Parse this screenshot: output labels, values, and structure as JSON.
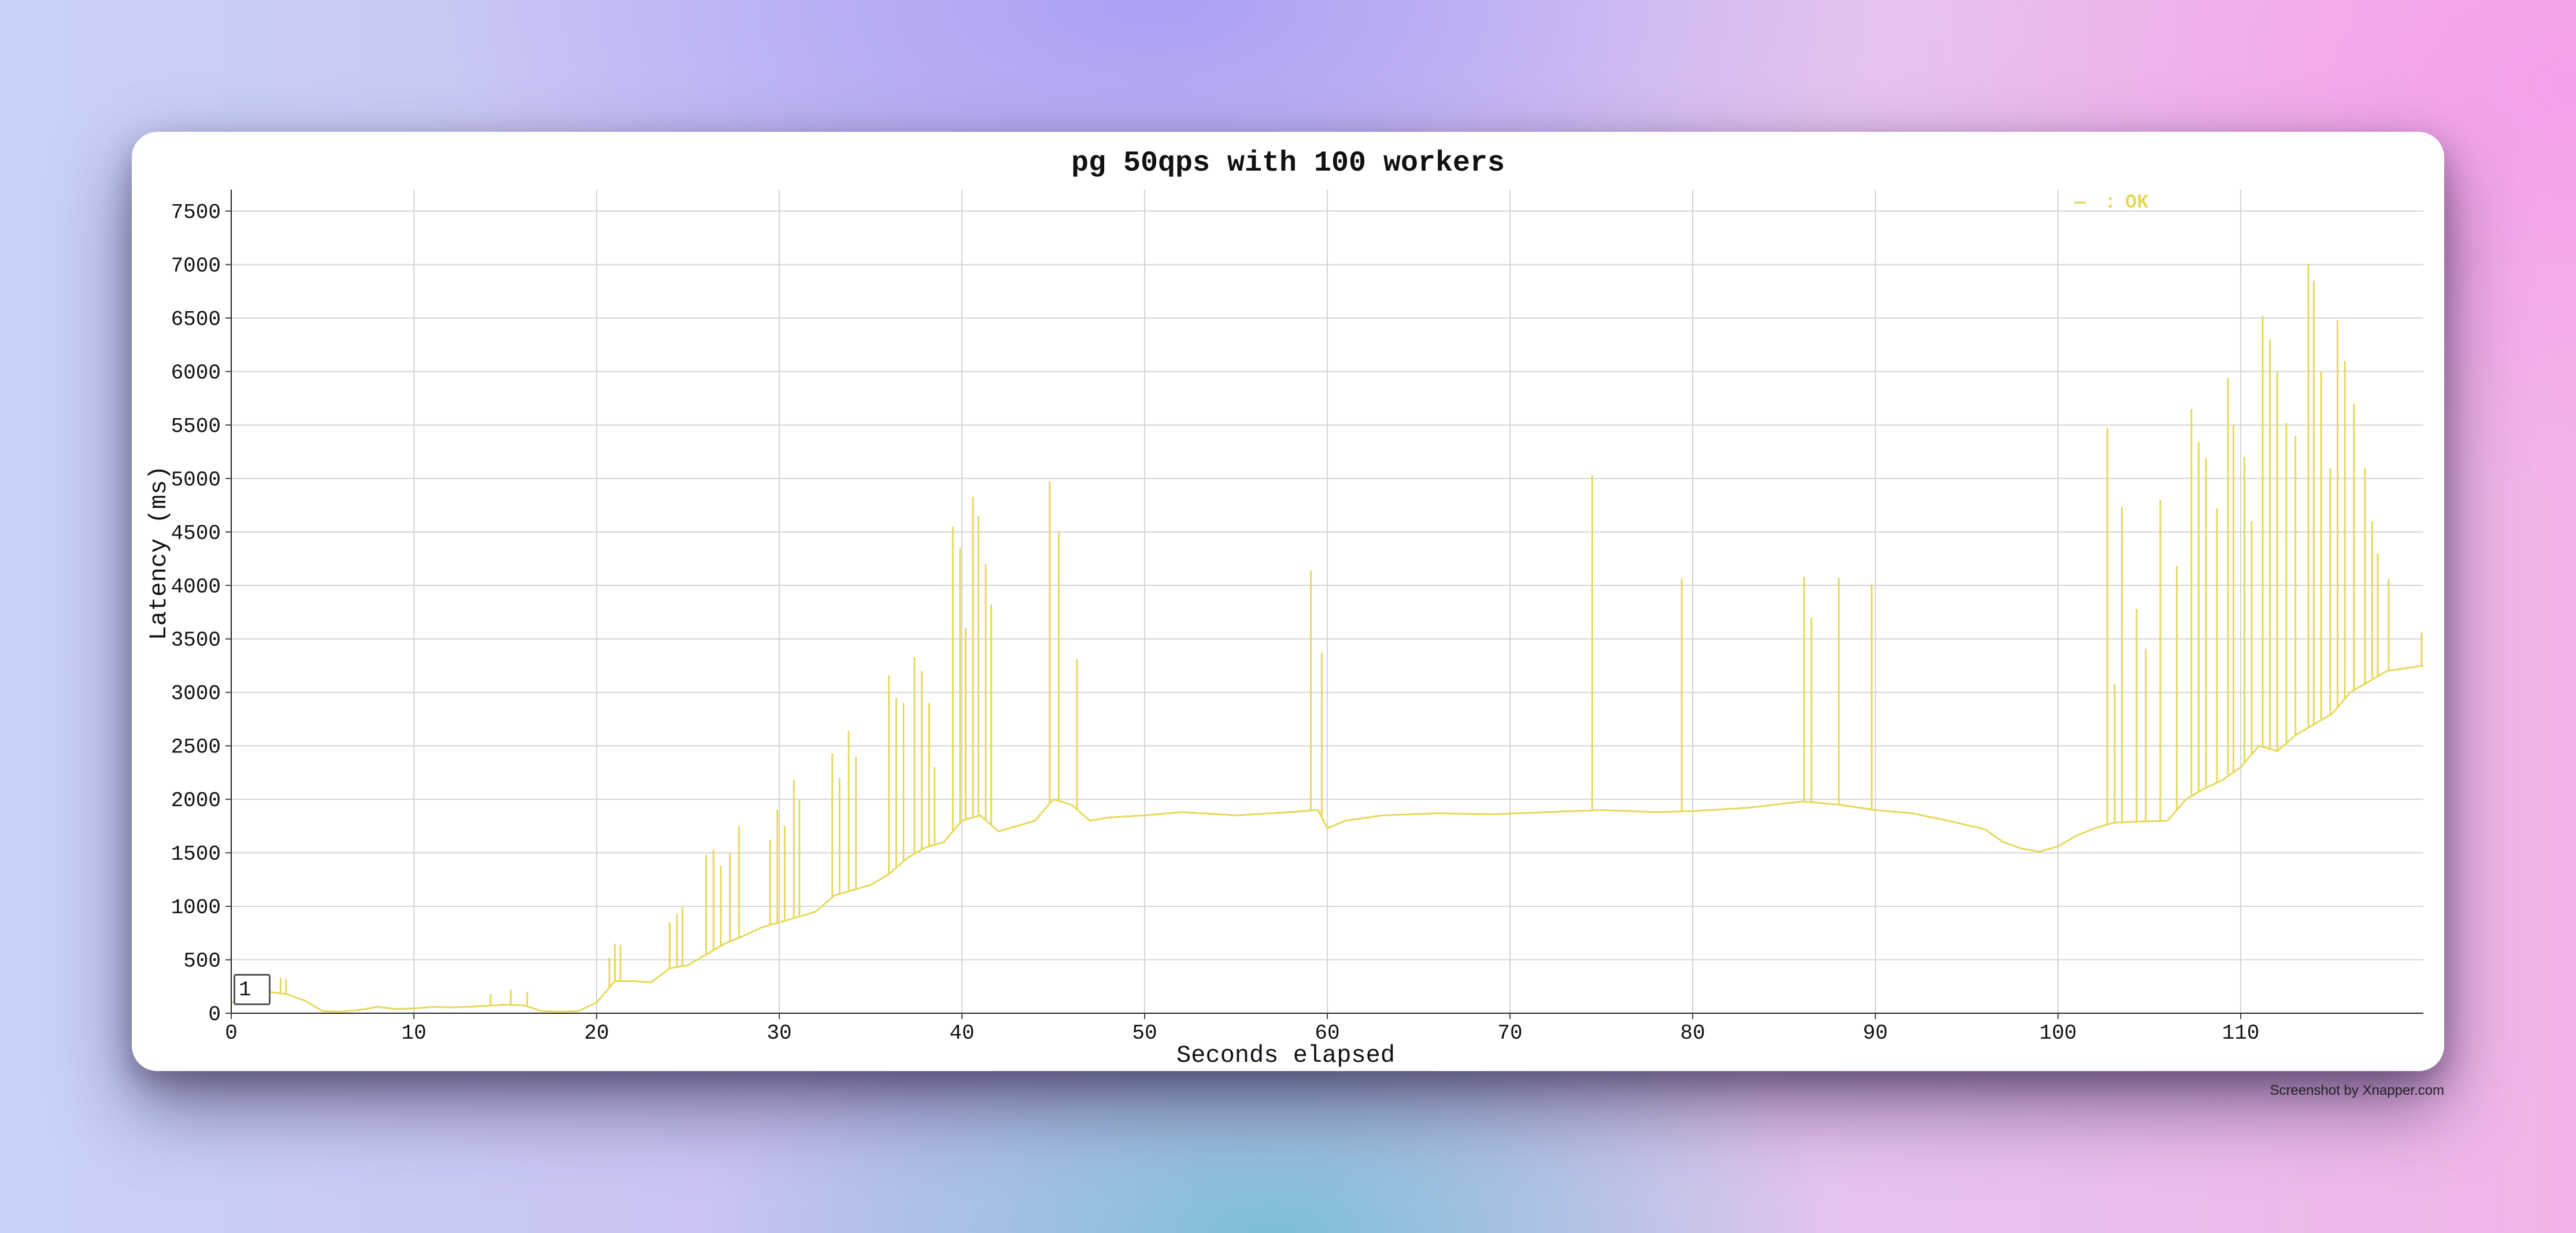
{
  "chart_data": {
    "type": "line",
    "title": "pg 50qps with 100 workers",
    "xlabel": "Seconds elapsed",
    "ylabel": "Latency (ms)",
    "xlim": [
      0,
      120
    ],
    "ylim": [
      0,
      7700
    ],
    "x_ticks": [
      0,
      10,
      20,
      30,
      40,
      50,
      60,
      70,
      80,
      90,
      100,
      110
    ],
    "y_ticks": [
      0,
      500,
      1000,
      1500,
      2000,
      2500,
      3000,
      3500,
      4000,
      4500,
      5000,
      5500,
      6000,
      6500,
      7000,
      7500
    ],
    "grid": true,
    "legend_position": "top-right",
    "series": [
      {
        "name": "OK",
        "color": "#e6d95a",
        "baseline": [
          [
            0,
            100
          ],
          [
            1,
            180
          ],
          [
            2,
            200
          ],
          [
            3,
            180
          ],
          [
            4,
            120
          ],
          [
            5,
            20
          ],
          [
            6,
            15
          ],
          [
            7,
            30
          ],
          [
            8,
            60
          ],
          [
            9,
            40
          ],
          [
            10,
            45
          ],
          [
            11,
            60
          ],
          [
            12,
            55
          ],
          [
            13,
            60
          ],
          [
            14,
            70
          ],
          [
            15,
            80
          ],
          [
            16,
            75
          ],
          [
            17,
            20
          ],
          [
            18,
            15
          ],
          [
            19,
            20
          ],
          [
            20,
            100
          ],
          [
            21,
            300
          ],
          [
            22,
            300
          ],
          [
            23,
            290
          ],
          [
            24,
            420
          ],
          [
            25,
            450
          ],
          [
            26,
            550
          ],
          [
            27,
            650
          ],
          [
            28,
            720
          ],
          [
            29,
            800
          ],
          [
            30,
            850
          ],
          [
            31,
            900
          ],
          [
            32,
            950
          ],
          [
            33,
            1100
          ],
          [
            34,
            1150
          ],
          [
            35,
            1200
          ],
          [
            36,
            1300
          ],
          [
            37,
            1450
          ],
          [
            38,
            1550
          ],
          [
            39,
            1600
          ],
          [
            40,
            1800
          ],
          [
            41,
            1850
          ],
          [
            42,
            1700
          ],
          [
            43,
            1750
          ],
          [
            44,
            1800
          ],
          [
            45,
            2000
          ],
          [
            46,
            1950
          ],
          [
            47,
            1800
          ],
          [
            48,
            1830
          ],
          [
            50,
            1850
          ],
          [
            52,
            1880
          ],
          [
            55,
            1850
          ],
          [
            58,
            1880
          ],
          [
            59.5,
            1900
          ],
          [
            60,
            1730
          ],
          [
            61,
            1800
          ],
          [
            63,
            1850
          ],
          [
            66,
            1870
          ],
          [
            69,
            1860
          ],
          [
            72,
            1880
          ],
          [
            75,
            1900
          ],
          [
            78,
            1880
          ],
          [
            80,
            1890
          ],
          [
            83,
            1920
          ],
          [
            86,
            1980
          ],
          [
            88,
            1950
          ],
          [
            90,
            1900
          ],
          [
            92,
            1870
          ],
          [
            94,
            1800
          ],
          [
            96,
            1720
          ],
          [
            97,
            1600
          ],
          [
            98,
            1540
          ],
          [
            99,
            1510
          ],
          [
            100,
            1560
          ],
          [
            101,
            1660
          ],
          [
            102,
            1730
          ],
          [
            103,
            1780
          ],
          [
            104,
            1790
          ],
          [
            106,
            1800
          ],
          [
            107,
            2000
          ],
          [
            108,
            2100
          ],
          [
            109,
            2180
          ],
          [
            110,
            2300
          ],
          [
            111,
            2500
          ],
          [
            112,
            2450
          ],
          [
            113,
            2600
          ],
          [
            114,
            2700
          ],
          [
            115,
            2800
          ],
          [
            116,
            3000
          ],
          [
            117,
            3100
          ],
          [
            118,
            3200
          ],
          [
            120,
            3250
          ]
        ],
        "spikes": [
          [
            2.7,
            330
          ],
          [
            3.0,
            320
          ],
          [
            14.2,
            180
          ],
          [
            15.3,
            220
          ],
          [
            16.2,
            200
          ],
          [
            20.7,
            520
          ],
          [
            21.0,
            650
          ],
          [
            21.3,
            640
          ],
          [
            24.0,
            850
          ],
          [
            24.4,
            930
          ],
          [
            24.7,
            990
          ],
          [
            26.0,
            1480
          ],
          [
            26.4,
            1530
          ],
          [
            26.8,
            1380
          ],
          [
            27.3,
            1500
          ],
          [
            27.8,
            1750
          ],
          [
            29.5,
            1620
          ],
          [
            29.9,
            1900
          ],
          [
            30.3,
            1750
          ],
          [
            30.8,
            2180
          ],
          [
            31.1,
            2000
          ],
          [
            32.9,
            2430
          ],
          [
            33.3,
            2200
          ],
          [
            33.8,
            2640
          ],
          [
            34.2,
            2400
          ],
          [
            36.0,
            3160
          ],
          [
            36.4,
            2950
          ],
          [
            36.8,
            2900
          ],
          [
            37.4,
            3330
          ],
          [
            37.8,
            3200
          ],
          [
            38.2,
            2900
          ],
          [
            38.5,
            2300
          ],
          [
            39.5,
            4550
          ],
          [
            39.9,
            4350
          ],
          [
            40.2,
            3600
          ],
          [
            40.6,
            4830
          ],
          [
            40.9,
            4650
          ],
          [
            41.3,
            4200
          ],
          [
            41.6,
            3820
          ],
          [
            44.8,
            4970
          ],
          [
            45.3,
            4500
          ],
          [
            46.3,
            3310
          ],
          [
            59.1,
            4140
          ],
          [
            59.7,
            3370
          ],
          [
            74.5,
            5030
          ],
          [
            79.4,
            4060
          ],
          [
            86.1,
            4080
          ],
          [
            86.5,
            3700
          ],
          [
            88.0,
            4070
          ],
          [
            89.8,
            4010
          ],
          [
            102.7,
            5470
          ],
          [
            103.1,
            3080
          ],
          [
            103.5,
            4730
          ],
          [
            104.3,
            3780
          ],
          [
            104.8,
            3410
          ],
          [
            105.6,
            4800
          ],
          [
            106.5,
            4180
          ],
          [
            107.3,
            5650
          ],
          [
            107.7,
            5340
          ],
          [
            108.1,
            5190
          ],
          [
            108.7,
            4720
          ],
          [
            109.3,
            5940
          ],
          [
            109.6,
            5500
          ],
          [
            110.2,
            5200
          ],
          [
            110.6,
            4600
          ],
          [
            111.2,
            6520
          ],
          [
            111.6,
            6300
          ],
          [
            112.0,
            6000
          ],
          [
            112.5,
            5520
          ],
          [
            113.0,
            5400
          ],
          [
            113.7,
            7010
          ],
          [
            114.0,
            6850
          ],
          [
            114.4,
            6000
          ],
          [
            114.9,
            5100
          ],
          [
            115.3,
            6480
          ],
          [
            115.7,
            6100
          ],
          [
            116.2,
            5700
          ],
          [
            116.8,
            5100
          ],
          [
            117.2,
            4600
          ],
          [
            117.5,
            4300
          ],
          [
            118.1,
            4060
          ],
          [
            119.9,
            3560
          ]
        ]
      }
    ]
  },
  "page_input": {
    "value": "1"
  },
  "credit": "Screenshot by Xnapper.com",
  "legend_marker": "—",
  "legend_separator": ":"
}
